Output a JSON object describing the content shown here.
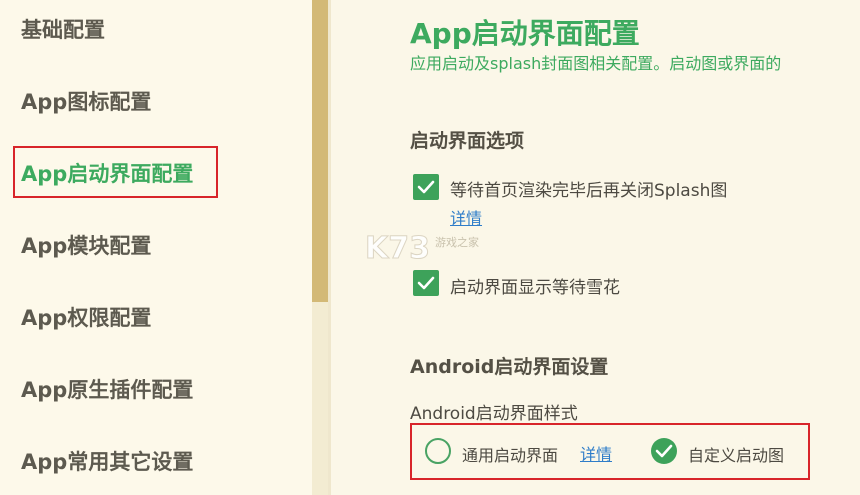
{
  "sidebar": {
    "items": [
      {
        "label": "基础配置"
      },
      {
        "label": "App图标配置"
      },
      {
        "label": "App启动界面配置"
      },
      {
        "label": "App模块配置"
      },
      {
        "label": "App权限配置"
      },
      {
        "label": "App原生插件配置"
      },
      {
        "label": "App常用其它设置"
      }
    ],
    "active_index": 2
  },
  "main": {
    "title": "App启动界面配置",
    "subtitle": "应用启动及splash封面图相关配置。启动图或界面的",
    "startup_options": {
      "heading": "启动界面选项",
      "wait_render": {
        "label": "等待首页渲染完毕后再关闭Splash图",
        "checked": true
      },
      "detail_link": "详情",
      "show_snow": {
        "label": "启动界面显示等待雪花",
        "checked": true
      }
    },
    "android": {
      "heading": "Android启动界面设置",
      "style_label": "Android启动界面样式",
      "options": [
        {
          "label": "通用启动界面",
          "selected": false,
          "detail_link": "详情"
        },
        {
          "label": "自定义启动图",
          "selected": true
        }
      ]
    }
  },
  "watermark": {
    "text": "K73",
    "sub": "游戏之家"
  },
  "colors": {
    "accent": "#3daa5f",
    "highlight_border": "#d8252a",
    "link": "#2f7dc9",
    "scrollbar": "#d3b976"
  }
}
